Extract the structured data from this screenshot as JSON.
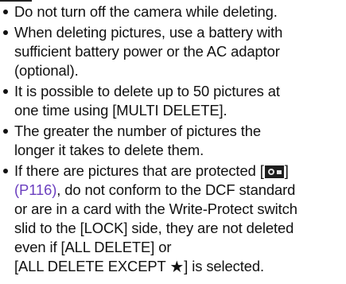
{
  "bullets": [
    {
      "lines": [
        "Do not turn off the camera while deleting."
      ]
    },
    {
      "lines": [
        "When deleting pictures, use a battery with",
        "sufficient battery power or the AC adaptor",
        "(optional)."
      ]
    },
    {
      "lines": [
        "It is possible to delete up to 50 pictures at",
        "one time using [MULTI DELETE]."
      ]
    },
    {
      "lines": [
        "The greater the number of pictures the",
        "longer it takes to delete them."
      ]
    },
    {
      "line1_before": "If there are pictures that are protected [",
      "line1_after": "]",
      "page_ref": "(P116)",
      "line2_after": ", do not conform to the DCF standard",
      "line3": "or are in a card with the Write-Protect switch",
      "line4": "slid to the [LOCK] side, they are not deleted",
      "line5": "even if [ALL DELETE] or",
      "line6_before": "[ALL DELETE EXCEPT ",
      "line6_after": "] is selected."
    }
  ],
  "colors": {
    "text": "#111111",
    "link": "#6b3fbf"
  }
}
